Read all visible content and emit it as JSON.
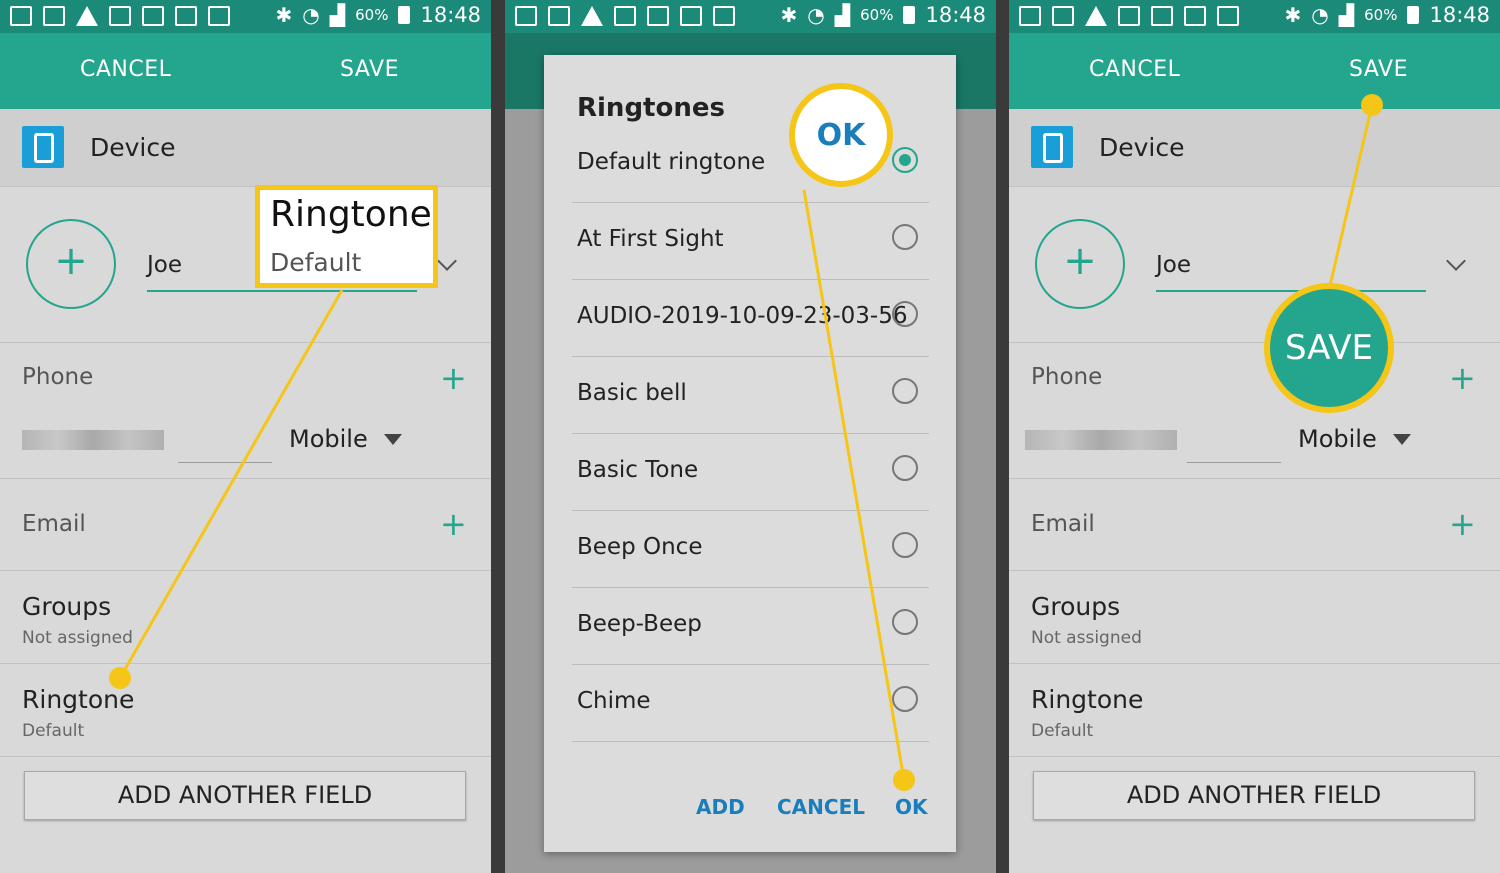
{
  "status": {
    "battery": "60%",
    "time": "18:48"
  },
  "contact": {
    "cancel": "CANCEL",
    "save": "SAVE",
    "device": "Device",
    "name": "Joe",
    "phone_label": "Phone",
    "phone_type": "Mobile",
    "email_label": "Email",
    "groups_label": "Groups",
    "groups_value": "Not assigned",
    "ringtone_label": "Ringtone",
    "ringtone_value": "Default",
    "add_field": "ADD ANOTHER FIELD"
  },
  "callouts": {
    "ringtone_title": "Ringtone",
    "ringtone_sub": "Default",
    "ok": "OK",
    "save": "SAVE"
  },
  "dialog": {
    "title": "Ringtones",
    "items": [
      {
        "label": "Default ringtone",
        "selected": true
      },
      {
        "label": "At First Sight",
        "selected": false
      },
      {
        "label": "AUDIO-2019-10-09-23-03-56",
        "selected": false
      },
      {
        "label": "Basic bell",
        "selected": false
      },
      {
        "label": "Basic Tone",
        "selected": false
      },
      {
        "label": "Beep Once",
        "selected": false
      },
      {
        "label": "Beep-Beep",
        "selected": false
      },
      {
        "label": "Chime",
        "selected": false
      }
    ],
    "add": "ADD",
    "cancel": "CANCEL",
    "ok": "OK"
  },
  "colors": {
    "accent": "#24a58d",
    "statusbar": "#1c8a78",
    "highlight": "#f5c518",
    "dialog_button": "#1a7ebc"
  }
}
